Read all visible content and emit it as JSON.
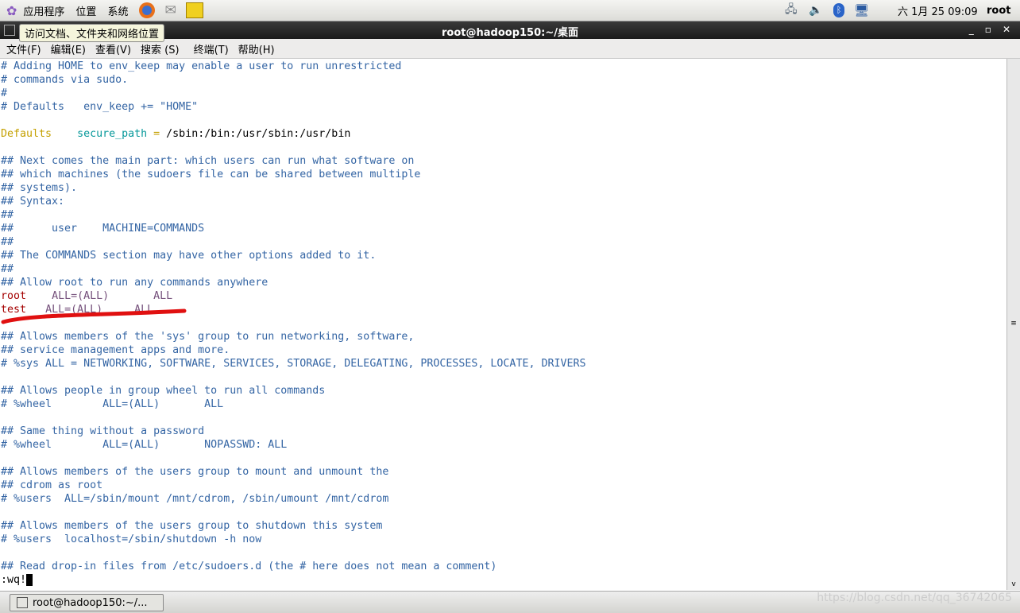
{
  "panel": {
    "menus": [
      "应用程序",
      "位置",
      "系统"
    ],
    "clock": "六 1月 25 09:09",
    "user": "root"
  },
  "window": {
    "title": "root@hadoop150:~/桌面",
    "tooltip": "访问文档、文件夹和网络位置"
  },
  "menubar": [
    "文件(F)",
    "编辑(E)",
    "查看(V)",
    "搜索 (S)",
    "终端(T)",
    "帮助(H)"
  ],
  "colors": {
    "comment": "#3465a4",
    "keyword": "#c4a000",
    "value": "#06989a",
    "user": "#a40000",
    "spec": "#75507b",
    "annotation": "#e01010"
  },
  "lines": [
    [
      [
        "c",
        "# Adding HOME to env_keep may enable a user to run unrestricted"
      ]
    ],
    [
      [
        "c",
        "# commands via sudo."
      ]
    ],
    [
      [
        "c",
        "#"
      ]
    ],
    [
      [
        "c",
        "# Defaults   env_keep += \"HOME\""
      ]
    ],
    [],
    [
      [
        "k",
        "Defaults"
      ],
      [
        "n",
        "    "
      ],
      [
        "v",
        "secure_path"
      ],
      [
        "k",
        " = "
      ],
      [
        "n",
        "/sbin:/bin:/usr/sbin:/usr/bin"
      ]
    ],
    [],
    [
      [
        "c",
        "## Next comes the main part: which users can run what software on"
      ]
    ],
    [
      [
        "c",
        "## which machines (the sudoers file can be shared between multiple"
      ]
    ],
    [
      [
        "c",
        "## systems)."
      ]
    ],
    [
      [
        "c",
        "## Syntax:"
      ]
    ],
    [
      [
        "c",
        "##"
      ]
    ],
    [
      [
        "c",
        "##      user    MACHINE=COMMANDS"
      ]
    ],
    [
      [
        "c",
        "##"
      ]
    ],
    [
      [
        "c",
        "## The COMMANDS section may have other options added to it."
      ]
    ],
    [
      [
        "c",
        "##"
      ]
    ],
    [
      [
        "c",
        "## Allow root to run any commands anywhere"
      ]
    ],
    [
      [
        "u",
        "root"
      ],
      [
        "n",
        "    "
      ],
      [
        "p",
        "ALL="
      ],
      [
        "p",
        "(ALL)"
      ],
      [
        "n",
        "       "
      ],
      [
        "p",
        "ALL"
      ]
    ],
    [
      [
        "u",
        "test"
      ],
      [
        "n",
        "   "
      ],
      [
        "p",
        "ALL="
      ],
      [
        "p",
        "(ALL)"
      ],
      [
        "n",
        "     "
      ],
      [
        "p",
        "ALL"
      ]
    ],
    [],
    [
      [
        "c",
        "## Allows members of the 'sys' group to run networking, software,"
      ]
    ],
    [
      [
        "c",
        "## service management apps and more."
      ]
    ],
    [
      [
        "c",
        "# %sys ALL = NETWORKING, SOFTWARE, SERVICES, STORAGE, DELEGATING, PROCESSES, LOCATE, DRIVERS"
      ]
    ],
    [],
    [
      [
        "c",
        "## Allows people in group wheel to run all commands"
      ]
    ],
    [
      [
        "c",
        "# %wheel        ALL=(ALL)       ALL"
      ]
    ],
    [],
    [
      [
        "c",
        "## Same thing without a password"
      ]
    ],
    [
      [
        "c",
        "# %wheel        ALL=(ALL)       NOPASSWD: ALL"
      ]
    ],
    [],
    [
      [
        "c",
        "## Allows members of the users group to mount and unmount the"
      ]
    ],
    [
      [
        "c",
        "## cdrom as root"
      ]
    ],
    [
      [
        "c",
        "# %users  ALL=/sbin/mount /mnt/cdrom, /sbin/umount /mnt/cdrom"
      ]
    ],
    [],
    [
      [
        "c",
        "## Allows members of the users group to shutdown this system"
      ]
    ],
    [
      [
        "c",
        "# %users  localhost=/sbin/shutdown -h now"
      ]
    ],
    [],
    [
      [
        "c",
        "## Read drop-in files from /etc/sudoers.d (the # here does not mean a comment)"
      ]
    ]
  ],
  "command": ":wq!",
  "taskbar": {
    "task": "root@hadoop150:~/...",
    "watermark": "https://blog.csdn.net/qq_36742065"
  }
}
